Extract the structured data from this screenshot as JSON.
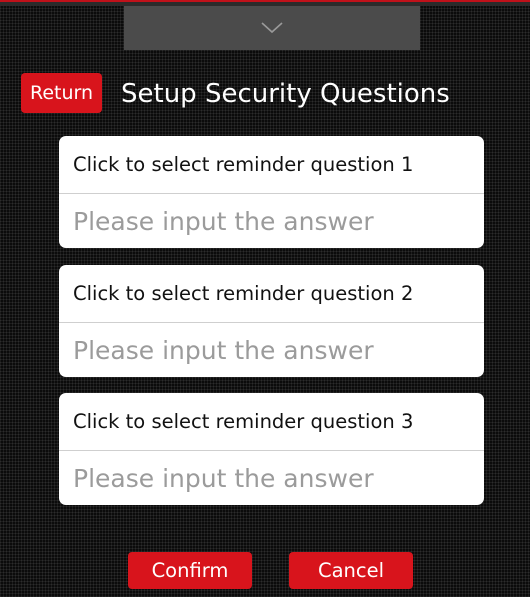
{
  "colors": {
    "accent": "#d8141c",
    "background": "#0b0b0b",
    "card": "#ffffff",
    "placeholder": "#9b9b9b",
    "pulldown": "#4b4b4b"
  },
  "header": {
    "return_label": "Return",
    "title": "Setup Security Questions",
    "pulldown_icon": "chevron-down-icon"
  },
  "questions": [
    {
      "question_label": "Click to select reminder question 1",
      "answer_value": "",
      "answer_placeholder": "Please input the answer"
    },
    {
      "question_label": "Click to select reminder question 2",
      "answer_value": "",
      "answer_placeholder": "Please input the answer"
    },
    {
      "question_label": "Click to select reminder question 3",
      "answer_value": "",
      "answer_placeholder": "Please input the answer"
    }
  ],
  "actions": {
    "confirm_label": "Confirm",
    "cancel_label": "Cancel"
  }
}
